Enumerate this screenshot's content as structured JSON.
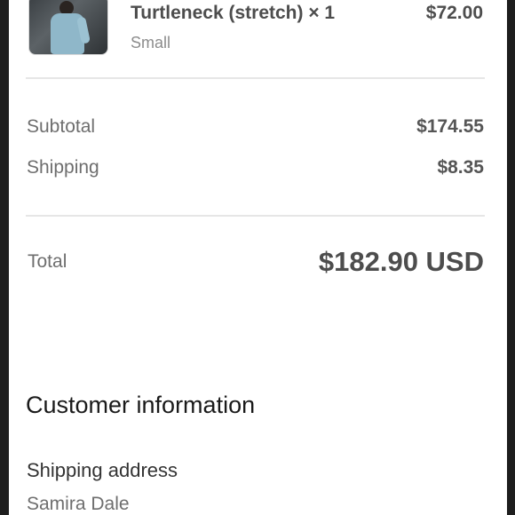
{
  "line_item": {
    "name": "Turtleneck (stretch) × 1",
    "variant": "Small",
    "price": "$72.00"
  },
  "summary": {
    "subtotal_label": "Subtotal",
    "subtotal_value": "$174.55",
    "shipping_label": "Shipping",
    "shipping_value": "$8.35",
    "total_label": "Total",
    "total_value": "$182.90 USD"
  },
  "customer": {
    "title": "Customer information",
    "shipping_heading": "Shipping address",
    "shipping_name": "Samira Dale"
  }
}
